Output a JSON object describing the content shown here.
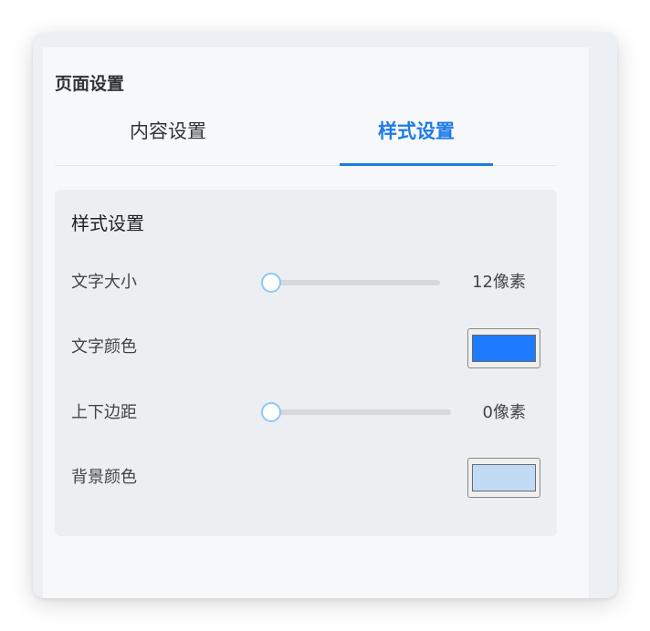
{
  "panel": {
    "title": "页面设置"
  },
  "tabs": [
    {
      "label": "内容设置",
      "active": false
    },
    {
      "label": "样式设置",
      "active": true
    }
  ],
  "section": {
    "title": "样式设置",
    "rows": {
      "font_size": {
        "label": "文字大小",
        "value_text": "12像素",
        "slider_fraction": 0
      },
      "text_color": {
        "label": "文字颜色",
        "color": "#1e7bff"
      },
      "vertical_margin": {
        "label": "上下边距",
        "value_text": "0像素",
        "slider_fraction": 0
      },
      "background_color": {
        "label": "背景颜色",
        "color": "#c2dbf5"
      }
    }
  },
  "colors": {
    "accent": "#1e7be6",
    "slider_thumb_border": "#8cc8f8"
  }
}
